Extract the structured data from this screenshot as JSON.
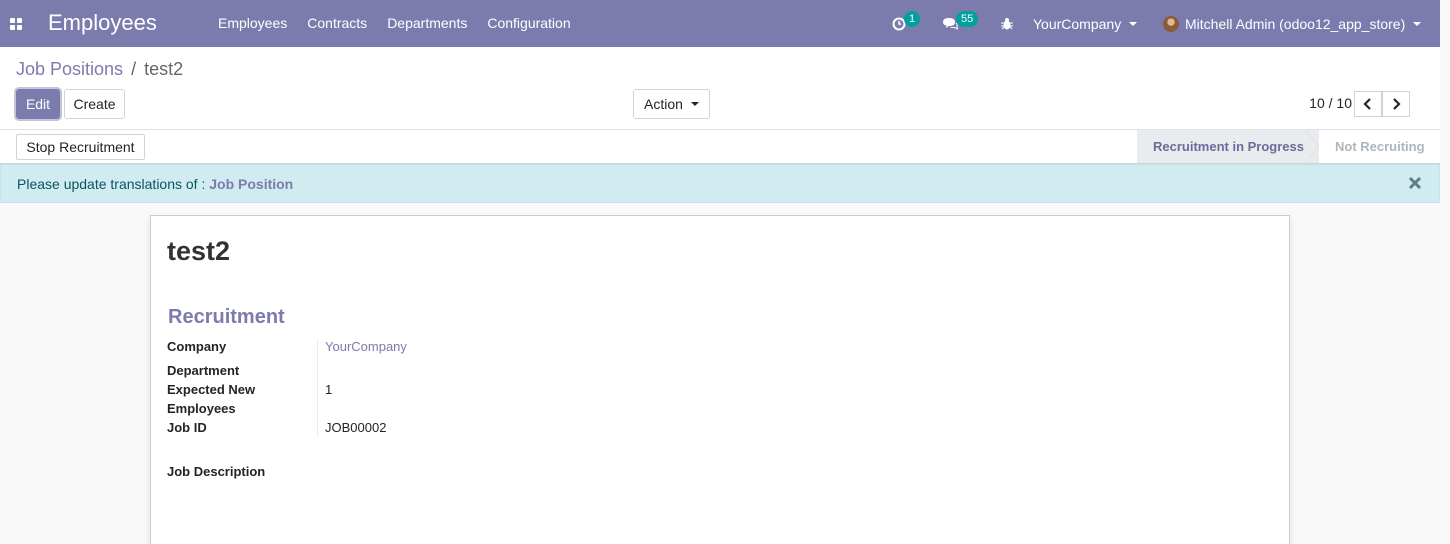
{
  "navbar": {
    "app_title": "Employees",
    "menu": [
      "Employees",
      "Contracts",
      "Departments",
      "Configuration"
    ],
    "activity_count": "1",
    "messages_count": "55",
    "company": "YourCompany",
    "user": "Mitchell Admin (odoo12_app_store)",
    "color": "#7c7bad"
  },
  "breadcrumb": {
    "parent": "Job Positions",
    "separator": "/",
    "current": "test2"
  },
  "buttons": {
    "edit": "Edit",
    "create": "Create",
    "action": "Action"
  },
  "pager": {
    "value": "10 / 10"
  },
  "statusbar": {
    "stop_button": "Stop Recruitment",
    "stages": [
      {
        "label": "Recruitment in Progress",
        "active": true
      },
      {
        "label": "Not Recruiting",
        "active": false
      }
    ]
  },
  "alert": {
    "text": "Please update translations of : ",
    "link": "Job Position"
  },
  "form": {
    "title": "test2",
    "group_title": "Recruitment",
    "fields": {
      "company": {
        "label": "Company",
        "value": "YourCompany"
      },
      "department": {
        "label": "Department",
        "value": ""
      },
      "expected_new_employees": {
        "label": "Expected New Employees",
        "value": "1"
      },
      "job_id": {
        "label": "Job ID",
        "value": "JOB00002"
      }
    },
    "job_description_label": "Job Description"
  }
}
